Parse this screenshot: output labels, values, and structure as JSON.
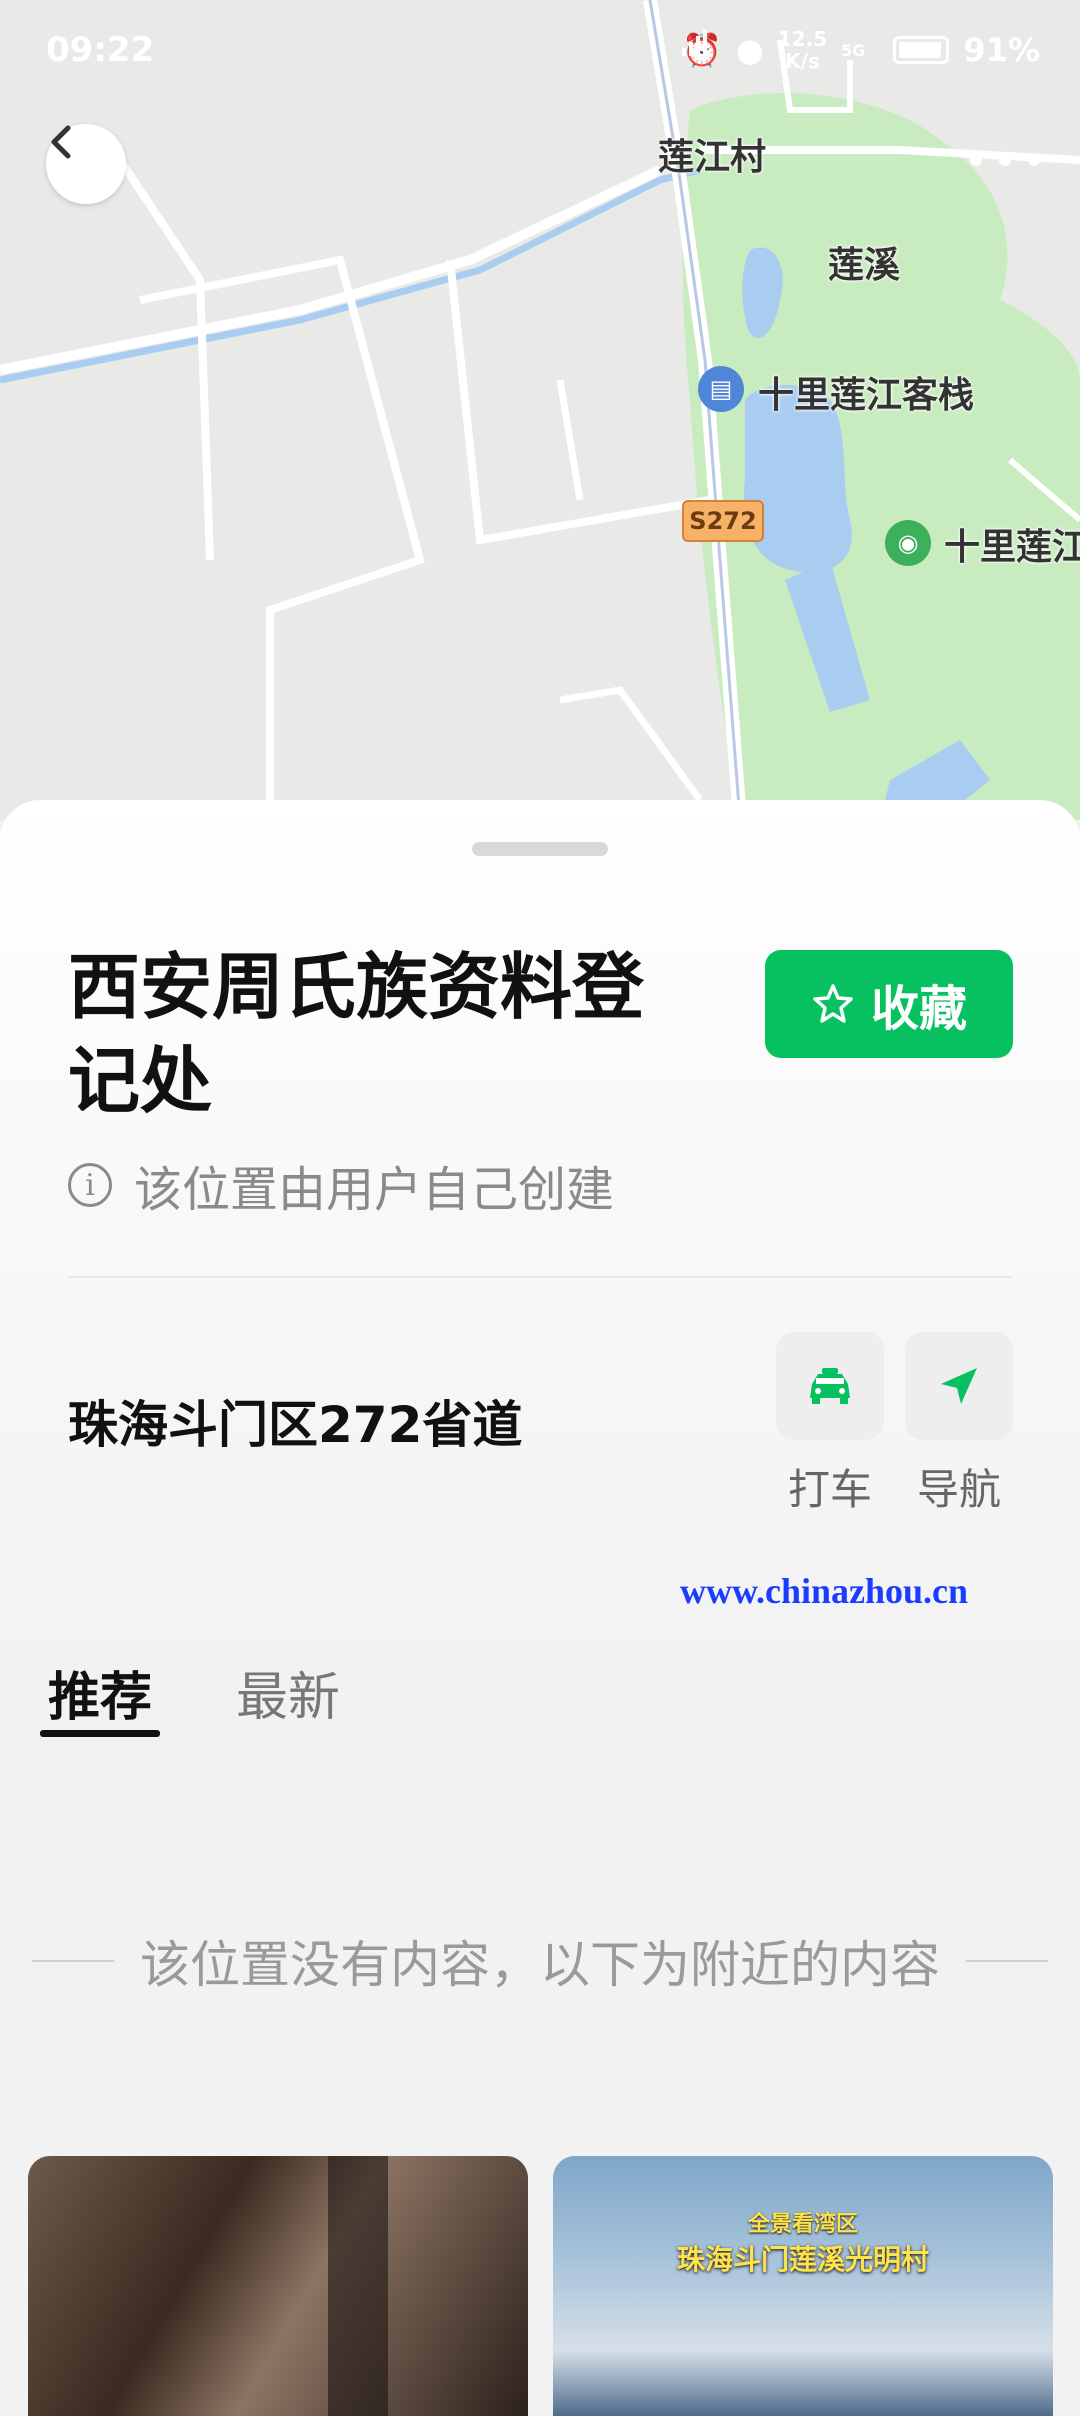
{
  "status_bar": {
    "time": "09:22",
    "network_speed": "12.5\nK/s",
    "signal": "5G",
    "battery": "91%"
  },
  "map": {
    "labels": {
      "village": "莲江村",
      "area": "莲溪",
      "hotel": "十里莲江客栈",
      "scenic": "十里莲江",
      "road_shield": "S272"
    },
    "colors": {
      "land": "#e9e9e7",
      "park": "#c9ebc0",
      "water": "#a9cdf0",
      "road": "#ffffff"
    }
  },
  "place": {
    "title": "西安周氏族资料登记处",
    "favorite_label": "收藏",
    "user_created_note": "该位置由用户自己创建",
    "address": "珠海斗门区272省道",
    "actions": {
      "taxi": "打车",
      "navigate": "导航"
    }
  },
  "tabs": {
    "recommend": "推荐",
    "latest": "最新"
  },
  "empty_message": "该位置没有内容，以下为附近的内容",
  "cards": {
    "card2_subtitle": "全景看湾区",
    "card2_title": "珠海斗门莲溪光明村"
  },
  "watermark": "www.chinazhou.cn",
  "accent": "#07c160"
}
